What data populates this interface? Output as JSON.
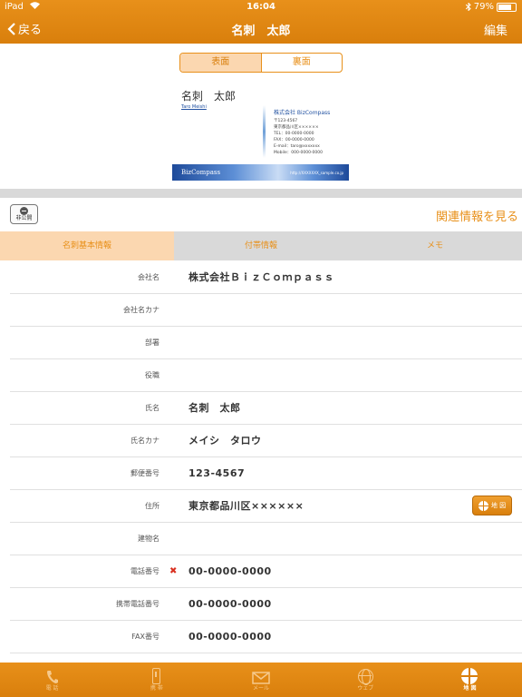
{
  "status": {
    "carrier": "iPad",
    "time": "16:04",
    "battery": "79%",
    "battery_level": 0.79
  },
  "nav": {
    "back_label": "戻る",
    "title": "名刺　太郎",
    "edit_label": "編集"
  },
  "card_toggle": {
    "front": "表面",
    "back": "裏面"
  },
  "card": {
    "name": "名刺　太郎",
    "name_en": "Taro Meishi",
    "company": "株式会社 BizCompass",
    "details": "〒123-4567\n東京都品川区××××××\nTEL：00-0000-0000\nFAX：00-0000-0000\nE-mail：taro@xxxxxxx\nMobile：000-0000-0000",
    "brand": "BizCompass",
    "url": "http://XXXXXXX_sample.co.jp"
  },
  "private_toggle": {
    "label": "非公開"
  },
  "related_link": "関連情報を見る",
  "tabs": [
    {
      "label": "名刺基本情報"
    },
    {
      "label": "付帯情報"
    },
    {
      "label": "メモ"
    }
  ],
  "fields": [
    {
      "label": "会社名",
      "value": "株式会社ＢｉｚＣｏｍｐａｓｓ"
    },
    {
      "label": "会社名カナ",
      "value": ""
    },
    {
      "label": "部署",
      "value": ""
    },
    {
      "label": "役職",
      "value": ""
    },
    {
      "label": "氏名",
      "value": "名刺　太郎"
    },
    {
      "label": "氏名カナ",
      "value": "メイシ　タロウ"
    },
    {
      "label": "郵便番号",
      "value": "123-4567"
    },
    {
      "label": "住所",
      "value": "東京都品川区××××××"
    },
    {
      "label": "建物名",
      "value": ""
    },
    {
      "label": "電話番号",
      "value": "00-0000-0000",
      "mark": "✖"
    },
    {
      "label": "携帯電話番号",
      "value": "00-0000-0000"
    },
    {
      "label": "FAX番号",
      "value": "00-0000-0000"
    }
  ],
  "map_button": {
    "label": "地 図"
  },
  "tabbar": [
    {
      "label": "電 話",
      "icon": "phone-icon"
    },
    {
      "label": "携 帯",
      "icon": "mobile-icon"
    },
    {
      "label": "メール",
      "icon": "mail-icon"
    },
    {
      "label": "ウェブ",
      "icon": "web-icon"
    },
    {
      "label": "地 図",
      "icon": "map-icon"
    }
  ],
  "colors": {
    "accent": "#E8901A",
    "accent_light": "#FBD7B0",
    "alert": "#D93020"
  }
}
